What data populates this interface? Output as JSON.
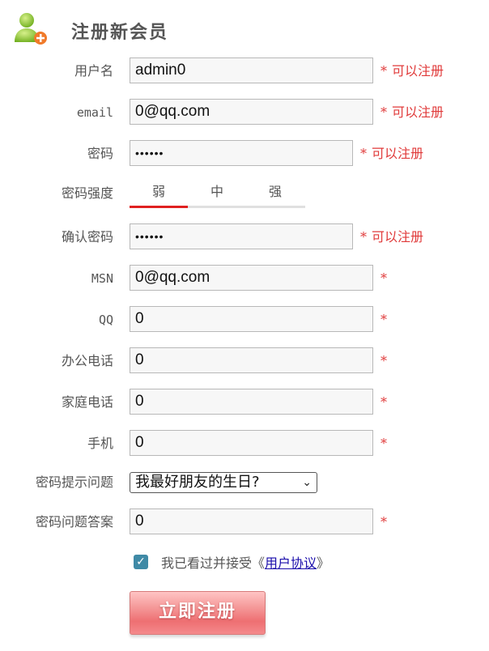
{
  "header": {
    "icon": "user-add-icon",
    "title": "注册新会员"
  },
  "form": {
    "username": {
      "label": "用户名",
      "value": "admin0",
      "required": "*",
      "status": "可以注册"
    },
    "email": {
      "label": "email",
      "value": "0@qq.com",
      "required": "*",
      "status": "可以注册"
    },
    "password": {
      "label": "密码",
      "value": "••••••",
      "required": "*",
      "status": "可以注册"
    },
    "strength": {
      "label": "密码强度",
      "levels": [
        "弱",
        "中",
        "强"
      ],
      "active_level": "弱"
    },
    "confirm": {
      "label": "确认密码",
      "value": "••••••",
      "required": "*",
      "status": "可以注册"
    },
    "msn": {
      "label": "MSN",
      "value": "0@qq.com",
      "required": "*"
    },
    "qq": {
      "label": "QQ",
      "value": "0",
      "required": "*"
    },
    "office_phone": {
      "label": "办公电话",
      "value": "0",
      "required": "*"
    },
    "home_phone": {
      "label": "家庭电话",
      "value": "0",
      "required": "*"
    },
    "mobile": {
      "label": "手机",
      "value": "0",
      "required": "*"
    },
    "question": {
      "label": "密码提示问题",
      "selected": "我最好朋友的生日?"
    },
    "answer": {
      "label": "密码问题答案",
      "value": "0",
      "required": "*"
    }
  },
  "agreement": {
    "checked": true,
    "prefix": "我已看过并接受《",
    "link": "用户协议",
    "suffix": "》"
  },
  "submit_label": "立即注册",
  "colors": {
    "required": "#e03a3a",
    "strength_active": "#e02020",
    "checkbox": "#3f8aa6",
    "button": "#ee6f72"
  }
}
